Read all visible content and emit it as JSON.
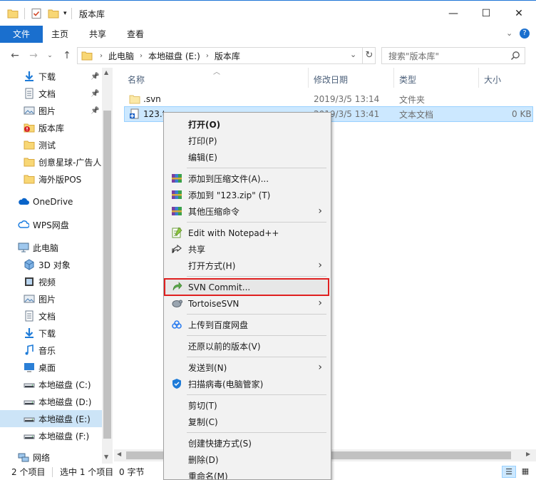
{
  "window": {
    "title": "版本库",
    "buttons": {
      "minimize": "—",
      "maximize": "☐",
      "close": "✕"
    }
  },
  "ribbon": {
    "tabs": [
      "文件",
      "主页",
      "共享",
      "查看"
    ]
  },
  "address": {
    "path": [
      "此电脑",
      "本地磁盘 (E:)",
      "版本库"
    ],
    "search_placeholder": "搜索\"版本库\""
  },
  "nav": {
    "items": [
      {
        "label": "下载",
        "icon": "download-icon",
        "pinned": true
      },
      {
        "label": "文档",
        "icon": "document-icon",
        "pinned": true
      },
      {
        "label": "图片",
        "icon": "picture-icon",
        "pinned": true
      },
      {
        "label": "版本库",
        "icon": "svn-folder-icon",
        "pinned": false
      },
      {
        "label": "测试",
        "icon": "folder-icon",
        "pinned": false
      },
      {
        "label": "创意星球-广告人",
        "icon": "folder-icon",
        "pinned": false
      },
      {
        "label": "海外版POS",
        "icon": "folder-icon",
        "pinned": false
      },
      {
        "label": "OneDrive",
        "icon": "cloud-icon",
        "pinned": false
      },
      {
        "label": "WPS网盘",
        "icon": "wps-cloud-icon",
        "pinned": false
      },
      {
        "label": "此电脑",
        "icon": "computer-icon",
        "pinned": false
      },
      {
        "label": "3D 对象",
        "icon": "3d-icon",
        "pinned": false
      },
      {
        "label": "视频",
        "icon": "video-icon",
        "pinned": false
      },
      {
        "label": "图片",
        "icon": "picture-icon",
        "pinned": false
      },
      {
        "label": "文档",
        "icon": "document-icon",
        "pinned": false
      },
      {
        "label": "下载",
        "icon": "download-icon",
        "pinned": false
      },
      {
        "label": "音乐",
        "icon": "music-icon",
        "pinned": false
      },
      {
        "label": "桌面",
        "icon": "desktop-icon",
        "pinned": false
      },
      {
        "label": "本地磁盘 (C:)",
        "icon": "drive-icon",
        "pinned": false
      },
      {
        "label": "本地磁盘 (D:)",
        "icon": "drive-icon",
        "pinned": false
      },
      {
        "label": "本地磁盘 (E:)",
        "icon": "drive-icon",
        "pinned": false,
        "selected": true
      },
      {
        "label": "本地磁盘 (F:)",
        "icon": "drive-icon",
        "pinned": false
      },
      {
        "label": "网络",
        "icon": "network-icon",
        "pinned": false
      }
    ]
  },
  "files": {
    "columns": [
      "名称",
      "修改日期",
      "类型",
      "大小"
    ],
    "rows": [
      {
        "name": ".svn",
        "date": "2019/3/5 13:14",
        "type": "文件夹",
        "size": ""
      },
      {
        "name": "123.t",
        "date": "2019/3/5 13:41",
        "type": "文本文档",
        "size": "0 KB"
      }
    ]
  },
  "status": {
    "count": "2 个项目",
    "selection": "选中 1 个项目",
    "size": "0 字节"
  },
  "context_menu": {
    "items": [
      {
        "label": "打开(O)",
        "bold": true
      },
      {
        "label": "打印(P)"
      },
      {
        "label": "编辑(E)"
      },
      {
        "label": "添加到压缩文件(A)...",
        "icon": "winrar-icon"
      },
      {
        "label": "添加到 \"123.zip\" (T)",
        "icon": "winrar-icon"
      },
      {
        "label": "其他压缩命令",
        "icon": "winrar-icon",
        "submenu": true
      },
      {
        "label": "Edit with Notepad++",
        "icon": "notepadpp-icon"
      },
      {
        "label": "共享",
        "icon": "share-icon"
      },
      {
        "label": "打开方式(H)",
        "submenu": true
      },
      {
        "label": "SVN Commit...",
        "icon": "svn-commit-icon",
        "highlighted": true
      },
      {
        "label": "TortoiseSVN",
        "icon": "tortoisesvn-icon",
        "submenu": true
      },
      {
        "label": "上传到百度网盘",
        "icon": "baidu-cloud-icon"
      },
      {
        "label": "还原以前的版本(V)"
      },
      {
        "label": "发送到(N)",
        "submenu": true
      },
      {
        "label": "扫描病毒(电脑管家)",
        "icon": "shield-icon"
      },
      {
        "label": "剪切(T)"
      },
      {
        "label": "复制(C)"
      },
      {
        "label": "创建快捷方式(S)"
      },
      {
        "label": "删除(D)"
      },
      {
        "label": "重命名(M)"
      }
    ]
  },
  "colors": {
    "accent": "#1a6fce",
    "selection": "#cce8ff",
    "highlight_border": "#e02020"
  }
}
